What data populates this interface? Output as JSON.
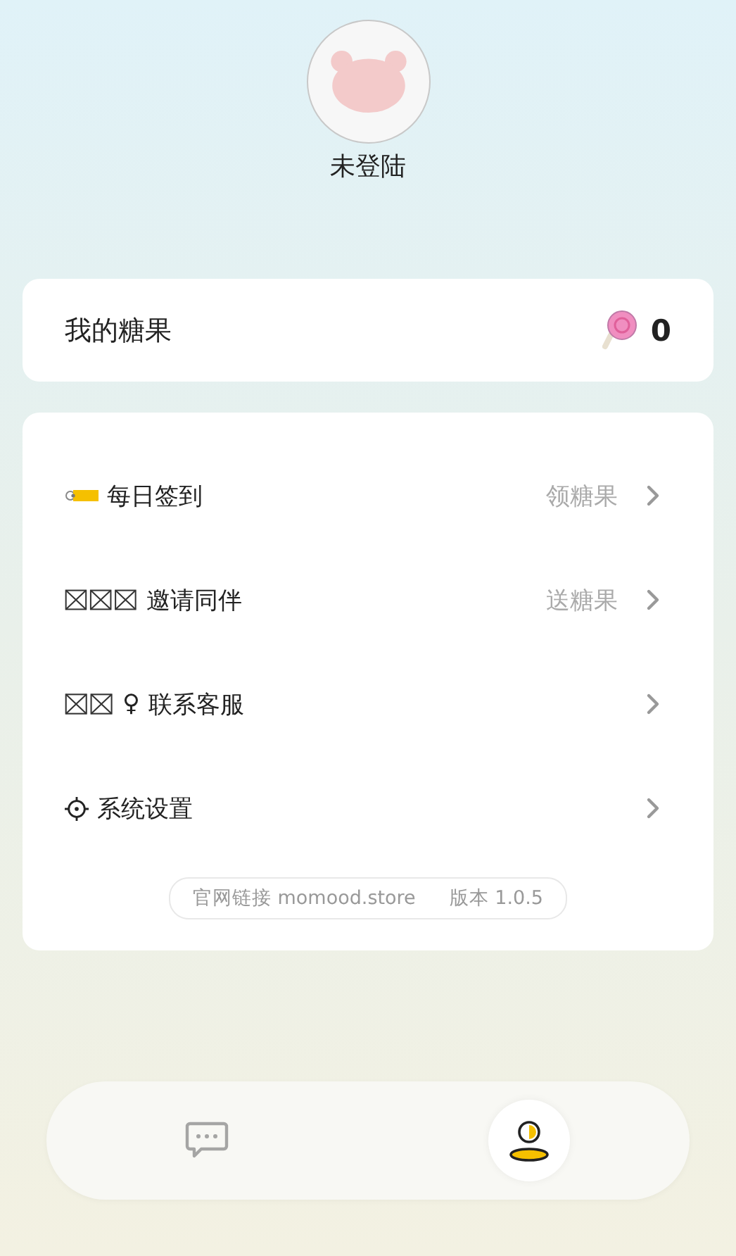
{
  "profile": {
    "name": "未登陆"
  },
  "candy": {
    "label": "我的糖果",
    "count": "0"
  },
  "menu": [
    {
      "kind": "tag",
      "label": "每日签到",
      "hint": "领糖果"
    },
    {
      "kind": "boxes3",
      "label": "邀请同伴",
      "hint": "送糖果"
    },
    {
      "kind": "boxes2",
      "symbol": "♀",
      "label": "联系客服"
    },
    {
      "kind": "gear",
      "label": "系统设置"
    }
  ],
  "footer": {
    "link": "官网链接 momood.store",
    "version": "版本 1.0.5"
  },
  "nav": [
    {
      "kind": "chat",
      "selected": false
    },
    {
      "kind": "user",
      "selected": true
    }
  ]
}
